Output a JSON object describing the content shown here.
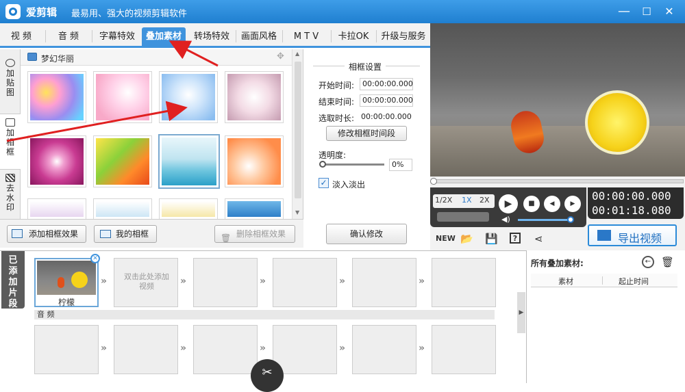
{
  "app": {
    "name": "爱剪辑",
    "slogan": "最易用、强大的视频剪辑软件"
  },
  "window_controls": {
    "minimize": "—",
    "maximize": "☐",
    "close": "✕"
  },
  "tabs": [
    {
      "label": "视  频"
    },
    {
      "label": "音  频"
    },
    {
      "label": "字幕特效"
    },
    {
      "label": "叠加素材",
      "active": true
    },
    {
      "label": "转场特效"
    },
    {
      "label": "画面风格"
    },
    {
      "label": "M T V"
    },
    {
      "label": "卡拉OK"
    },
    {
      "label": "升级与服务"
    }
  ],
  "side_tabs": [
    {
      "label": "加贴图"
    },
    {
      "label": "加相框"
    },
    {
      "label": "去水印"
    }
  ],
  "gallery": {
    "category": "梦幻华丽"
  },
  "frame_settings": {
    "title": "相框设置",
    "start_label": "开始时间:",
    "start_value": "00:00:00.000",
    "end_label": "结束时间:",
    "end_value": "00:00:00.000",
    "duration_label": "选取时长:",
    "duration_value": "00:00:00.000",
    "modify_time_button": "修改相框时间段",
    "opacity_label": "透明度:",
    "opacity_value": "0%",
    "fade_label": "淡入淡出",
    "fade_checked": true,
    "confirm_button": "确认修改"
  },
  "left_actions": {
    "add_frame": "添加相框效果",
    "my_frames": "我的相框",
    "delete_frame": "删除相框效果"
  },
  "player": {
    "speeds": [
      "1/2X",
      "1X",
      "2X"
    ],
    "active_speed": "1X",
    "current_time": "00:00:00.000",
    "total_time": "00:01:18.080",
    "export_button": "导出视频"
  },
  "timeline": {
    "added_label": "已添加片段",
    "clip_name": "柠檬",
    "add_hint": "双击此处添加视频",
    "audio_label": "音 频"
  },
  "overlay_panel": {
    "title": "所有叠加素材:",
    "col_material": "素材",
    "col_time": "起止时间"
  },
  "colors": {
    "accent": "#3f93dd",
    "title_bar": "#1f7fd0",
    "arrow": "#e02020"
  }
}
